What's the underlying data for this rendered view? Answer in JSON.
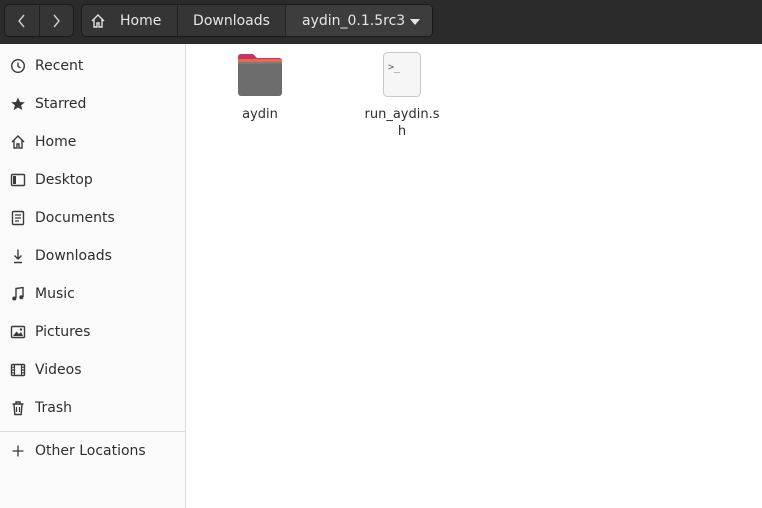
{
  "header": {
    "nav": {
      "back_icon": "chevron-left-icon",
      "forward_icon": "chevron-right-icon"
    },
    "breadcrumbs": [
      {
        "label": "Home",
        "icon": "home-icon"
      },
      {
        "label": "Downloads"
      },
      {
        "label": "aydin_0.1.5rc3",
        "icon": "dropdown-arrow-icon"
      }
    ]
  },
  "sidebar": {
    "items": [
      {
        "label": "Recent",
        "icon": "clock-icon"
      },
      {
        "label": "Starred",
        "icon": "star-icon"
      },
      {
        "label": "Home",
        "icon": "home-icon"
      },
      {
        "label": "Desktop",
        "icon": "desktop-icon"
      },
      {
        "label": "Documents",
        "icon": "document-icon"
      },
      {
        "label": "Downloads",
        "icon": "download-icon"
      },
      {
        "label": "Music",
        "icon": "music-note-icon"
      },
      {
        "label": "Pictures",
        "icon": "picture-icon"
      },
      {
        "label": "Videos",
        "icon": "film-icon"
      },
      {
        "label": "Trash",
        "icon": "trash-icon"
      }
    ],
    "other_locations": {
      "label": "Other Locations",
      "icon": "plus-icon"
    }
  },
  "files": [
    {
      "name": "aydin",
      "type": "folder",
      "icon": "folder-icon"
    },
    {
      "name": "run_aydin.sh",
      "type": "script",
      "icon": "terminal-script-icon"
    }
  ],
  "colors": {
    "header_bg": "#2b2b2b",
    "folder_tab": "#c8345c",
    "folder_body": "#6d6d6d"
  }
}
